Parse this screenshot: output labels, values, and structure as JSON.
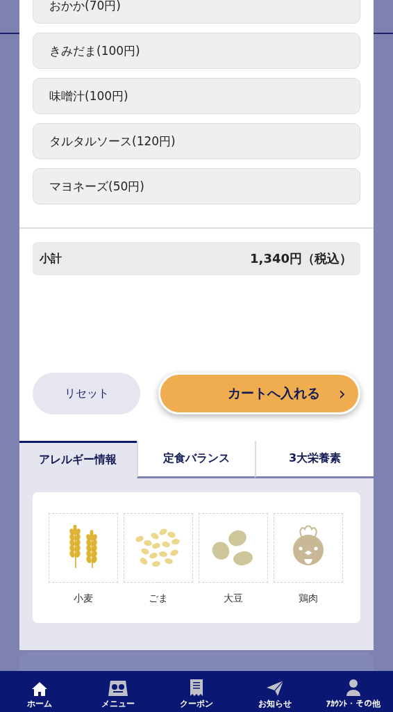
{
  "options": [
    {
      "label": "おかか(70円)"
    },
    {
      "label": "きみだま(100円)"
    },
    {
      "label": "味噌汁(100円)"
    },
    {
      "label": "タルタルソース(120円)"
    },
    {
      "label": "マヨネーズ(50円)"
    }
  ],
  "subtotal": {
    "label": "小計",
    "value": "1,340円（税込）"
  },
  "buttons": {
    "reset": "リセット",
    "add_to_cart": "カートへ入れる",
    "chevron": "›"
  },
  "tabs": [
    {
      "label": "アレルギー情報",
      "selected": true
    },
    {
      "label": "定食バランス",
      "selected": false
    },
    {
      "label": "3大栄養素",
      "selected": false
    }
  ],
  "allergens": [
    {
      "kind": "wheat",
      "name": "小麦"
    },
    {
      "kind": "sesame",
      "name": "ごま"
    },
    {
      "kind": "soy",
      "name": "大豆"
    },
    {
      "kind": "chicken",
      "name": "鶏肉"
    }
  ],
  "nav": [
    {
      "kind": "home",
      "label": "ホーム",
      "selected": true
    },
    {
      "kind": "menu",
      "label": "メニュー",
      "selected": false
    },
    {
      "kind": "coupon",
      "label": "クーポン",
      "selected": false
    },
    {
      "kind": "news",
      "label": "お知らせ",
      "selected": false
    },
    {
      "kind": "account",
      "label": "ｱｶｳﾝﾄ・その他",
      "selected": false
    }
  ]
}
